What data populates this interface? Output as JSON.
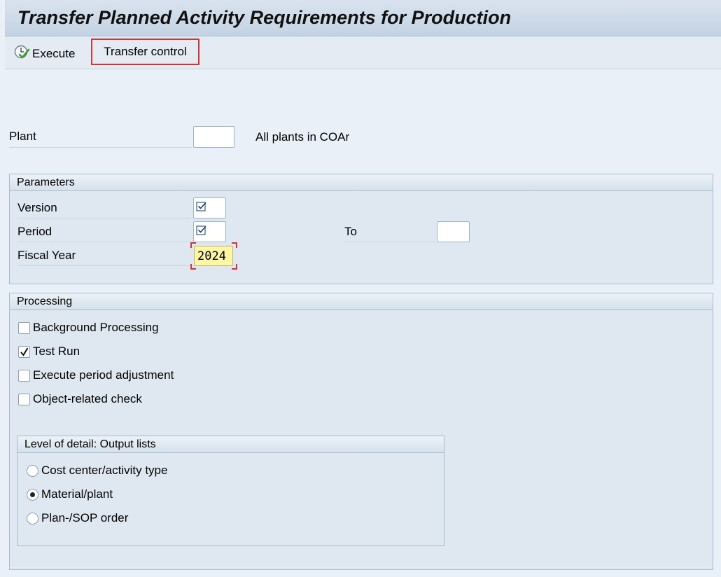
{
  "title": "Transfer Planned Activity Requirements for Production",
  "toolbar": {
    "execute_label": "Execute",
    "transfer_control_label": "Transfer control"
  },
  "plant": {
    "label": "Plant",
    "value": "",
    "hint": "All plants in COAr"
  },
  "parameters": {
    "title": "Parameters",
    "version_label": "Version",
    "period_label": "Period",
    "to_label": "To",
    "to_value": "",
    "fiscal_year_label": "Fiscal Year",
    "fiscal_year_value": "2024"
  },
  "processing": {
    "title": "Processing",
    "checkboxes": [
      {
        "label": "Background Processing",
        "checked": false
      },
      {
        "label": "Test Run",
        "checked": true
      },
      {
        "label": "Execute period adjustment",
        "checked": false
      },
      {
        "label": "Object-related check",
        "checked": false
      }
    ],
    "detail": {
      "title": "Level of detail: Output lists",
      "options": [
        {
          "label": "Cost center/activity type",
          "selected": false
        },
        {
          "label": "Material/plant",
          "selected": true
        },
        {
          "label": "Plan-/SOP order",
          "selected": false
        }
      ]
    }
  },
  "colors": {
    "background": "#e9f0f7",
    "highlight_border": "#d8323a",
    "fiscal_year_bg": "#fff6a8"
  }
}
